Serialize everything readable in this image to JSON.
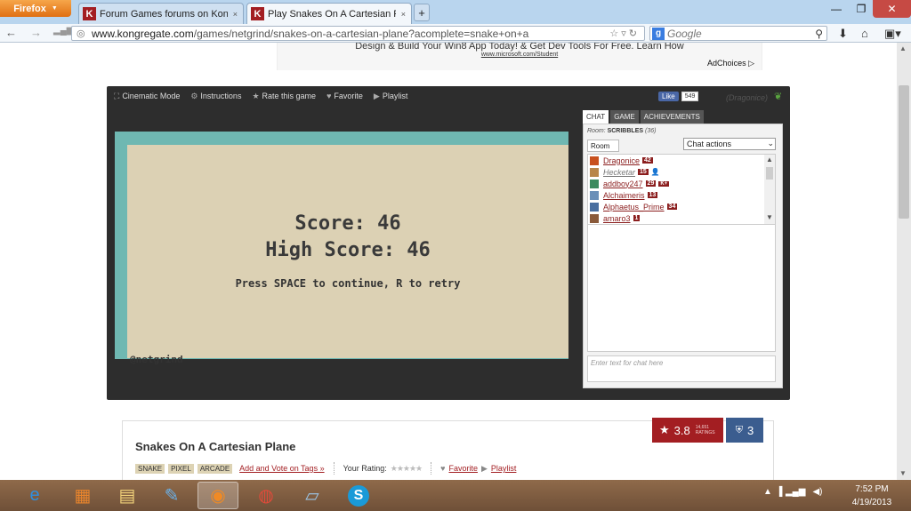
{
  "browser": {
    "menu_label": "Firefox",
    "tabs": [
      {
        "label": "Forum Games forums on Kon...",
        "close": "×"
      },
      {
        "label": "Play Snakes On A Cartesian Pl...",
        "close": "×"
      }
    ],
    "new_tab": "+",
    "url_host": "www.kongregate.com",
    "url_path": "/games/netgrind/snakes-on-a-cartesian-plane?acomplete=snake+on+a",
    "search_placeholder": "Google"
  },
  "ad": {
    "text": "Design & Build Your Win8 App Today! & Get Dev Tools For Free. Learn How",
    "link": "www.microsoft.com/Student",
    "adchoices": "AdChoices ▷"
  },
  "game_toolbar": {
    "cinematic": "Cinematic Mode",
    "instructions": "Instructions",
    "rate": "Rate this game",
    "favorite": "Favorite",
    "playlist": "Playlist",
    "fb_like": "Like",
    "fb_count": "549",
    "username": "(Dragonice)"
  },
  "game_screen": {
    "score": "Score: 46",
    "high_score": "High Score: 46",
    "prompt": "Press SPACE to continue, R to retry",
    "handle": "@netgrind"
  },
  "chat": {
    "tabs": [
      "CHAT",
      "GAME",
      "ACHIEVEMENTS"
    ],
    "room_label": "Room:",
    "room_name": "SCRIBBLES",
    "room_count": "(36)",
    "room_tab": "Room",
    "actions": "Chat actions",
    "input_placeholder": "Enter text for chat here",
    "users": [
      {
        "name": "Dragonice",
        "level": "42",
        "extra": ""
      },
      {
        "name": "Hecketar",
        "level": "15",
        "extra": "person"
      },
      {
        "name": "addboy247",
        "level": "29",
        "extra": "K+"
      },
      {
        "name": "Alchaimeris",
        "level": "13",
        "extra": ""
      },
      {
        "name": "Alphaetus_Prime",
        "level": "34",
        "extra": ""
      },
      {
        "name": "amaro3",
        "level": "1",
        "extra": ""
      }
    ]
  },
  "game_info": {
    "title": "Snakes On A Cartesian Plane",
    "tags": [
      "SNAKE",
      "PIXEL",
      "ARCADE"
    ],
    "add_tags": "Add and Vote on Tags »",
    "your_rating": "Your Rating:",
    "favorite": "Favorite",
    "playlist": "Playlist",
    "rating": "3.8",
    "ratings_count": "14,651",
    "ratings_label": "RATINGS",
    "badges": "3"
  },
  "taskbar": {
    "time": "7:52 PM",
    "date": "4/19/2013"
  }
}
